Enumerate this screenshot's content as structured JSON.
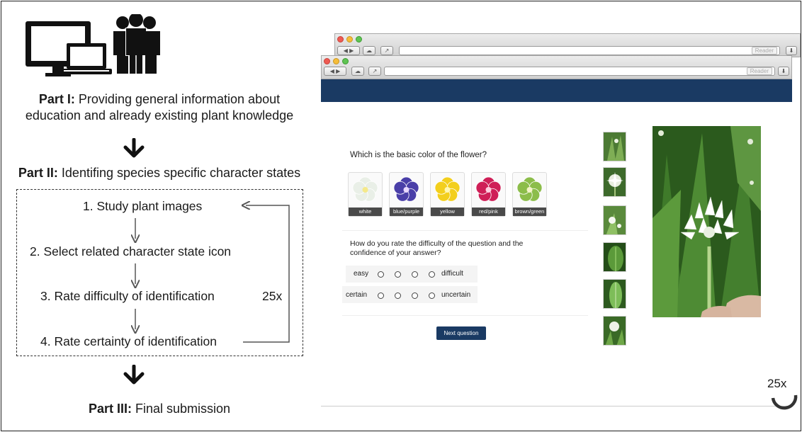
{
  "left": {
    "part1_bold": "Part I:",
    "part1_text": "Providing general  information about",
    "part1_text2": "education and already existing plant knowledge",
    "part2_bold": "Part II:",
    "part2_text": "Identifing species specific character states",
    "steps": [
      "1. Study plant images",
      "2. Select related character state icon",
      "3. Rate difficulty of identification",
      "4. Rate certainty of identification"
    ],
    "repeat_label": "25x",
    "part3_bold": "Part III:",
    "part3_text": "Final submission"
  },
  "browser": {
    "reader_label": "Reader"
  },
  "survey": {
    "question": "Which is the basic color of the flower?",
    "colors": [
      {
        "label": "white",
        "petal": "#e9efe7",
        "center": "#f5e98a"
      },
      {
        "label": "blue/purple",
        "petal": "#4a3fa8",
        "center": "#e9d9ff"
      },
      {
        "label": "yellow",
        "petal": "#f3cf1d",
        "center": "#fff7b3"
      },
      {
        "label": "red/pink",
        "petal": "#cf1f57",
        "center": "#ffd0e0"
      },
      {
        "label": "brown/green",
        "petal": "#8cbd4a",
        "center": "#f4f4c8"
      }
    ],
    "rating_question_line1": "How do you rate the difficulty of the question and the",
    "rating_question_line2": "confidence of your answer?",
    "difficulty_left": "easy",
    "difficulty_right": "difficult",
    "certainty_left": "certain",
    "certainty_right": "uncertain",
    "next_button": "Next question"
  },
  "corner_repeat_label": "25x",
  "colors": {
    "header_blue": "#1a3a63",
    "leaf_green": "#2f6a22"
  }
}
